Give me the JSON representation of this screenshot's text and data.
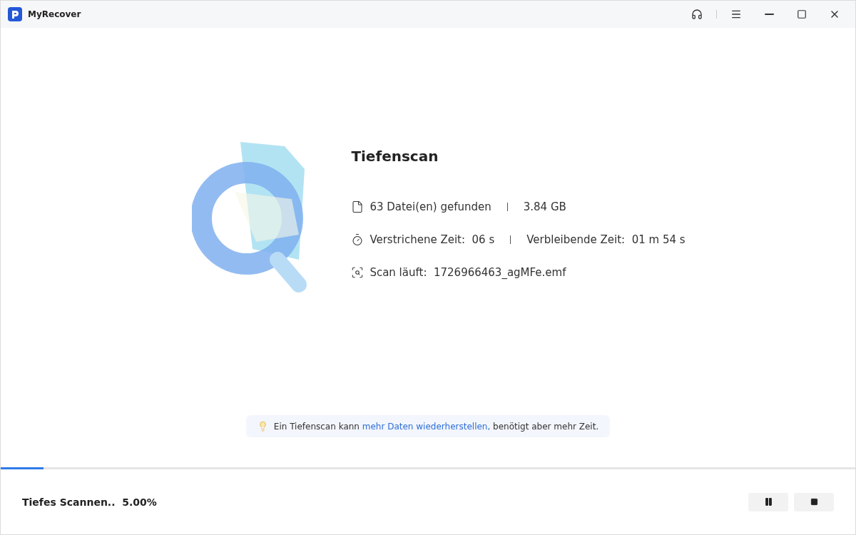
{
  "window": {
    "title": "MyRecover"
  },
  "scan": {
    "title": "Tiefenscan",
    "rows": [
      {
        "kind": "file",
        "parts": [
          "63 Datei(en) gefunden",
          "3.84 GB"
        ]
      },
      {
        "kind": "timer",
        "parts": [
          "Verstrichene Zeit:  06 s",
          "Verbleibende Zeit:  01 m 54 s"
        ]
      },
      {
        "kind": "scan",
        "parts": [
          "Scan läuft:  1726966463_agMFe.emf"
        ]
      }
    ]
  },
  "tip": {
    "before": "Ein Tiefenscan kann ",
    "link": "mehr Daten wiederherstellen,",
    "after": " benötigt aber mehr Zeit."
  },
  "progress": {
    "level": 0.05,
    "label": "Tiefes Scannen..",
    "percent": "5.00%"
  }
}
